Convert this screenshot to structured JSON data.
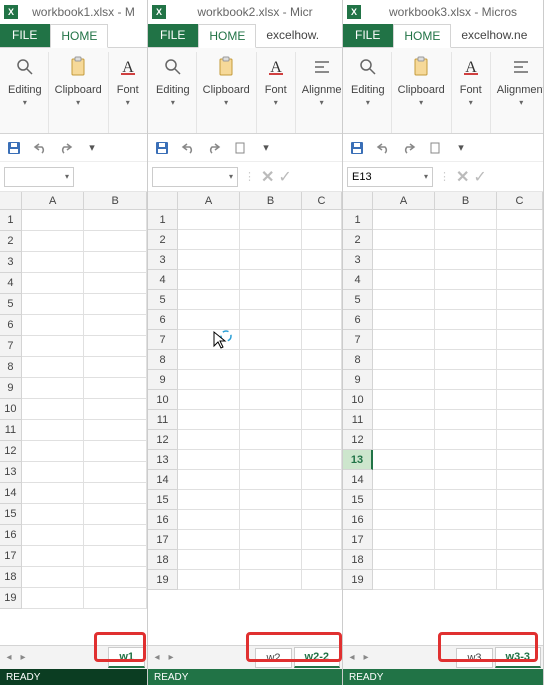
{
  "windows": [
    {
      "title": "workbook1.xlsx - M",
      "tabs": {
        "file": "FILE",
        "home": "HOME"
      },
      "ribbon": {
        "editing": "Editing",
        "clipboard": "Clipboard",
        "font": "Font"
      },
      "namebox": "",
      "columns": [
        "A",
        "B"
      ],
      "row_count": 19,
      "sheet_tabs": [
        {
          "label": "w1",
          "active": true
        }
      ],
      "status": "READY"
    },
    {
      "title": "workbook2.xlsx - Micr",
      "tabs": {
        "file": "FILE",
        "home": "HOME",
        "extra": "excelhow."
      },
      "ribbon": {
        "editing": "Editing",
        "clipboard": "Clipboard",
        "font": "Font",
        "alignment": "Alignme"
      },
      "namebox": "",
      "columns": [
        "A",
        "B",
        "C"
      ],
      "row_count": 19,
      "sheet_tabs": [
        {
          "label": "w2",
          "active": false
        },
        {
          "label": "w2-2",
          "active": true
        }
      ],
      "status": "READY"
    },
    {
      "title": "workbook3.xlsx - Micros",
      "tabs": {
        "file": "FILE",
        "home": "HOME",
        "extra": "excelhow.ne"
      },
      "ribbon": {
        "editing": "Editing",
        "clipboard": "Clipboard",
        "font": "Font",
        "alignment": "Alignment"
      },
      "namebox": "E13",
      "columns": [
        "A",
        "B",
        "C"
      ],
      "row_count": 19,
      "selected_row": 13,
      "sheet_tabs": [
        {
          "label": "w3",
          "active": false
        },
        {
          "label": "w3-3",
          "active": true
        }
      ],
      "status": "READY"
    }
  ]
}
